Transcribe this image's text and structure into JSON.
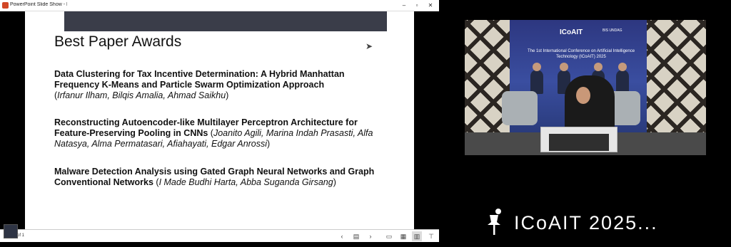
{
  "window": {
    "title": "PowerPoint Slide Show - Pres",
    "controls": [
      "–",
      "▫",
      "✕"
    ]
  },
  "slide": {
    "title": "Best Paper Awards",
    "papers": [
      {
        "title": "Data Clustering for Tax Incentive Determination: A Hybrid Manhattan Frequency K-Means and Particle Swarm Optimization Approach",
        "authors": "Irfanur Ilham, Bilqis Amalia, Ahmad Saikhu"
      },
      {
        "title": "Reconstructing Autoencoder-like Multilayer Perceptron Architecture for Feature-Preserving Pooling in CNNs",
        "authors": "Joanito Agili, Marina Indah Prasasti, Alfa Natasya, Alma Permatasari, Afiahayati, Edgar Anrossi"
      },
      {
        "title": "Malware Detection Analysis using Gated Graph Neural Networks and Graph Conventional Networks",
        "authors": "I Made Budhi Harta, Abba Suganda Girsang"
      }
    ]
  },
  "status_bar": {
    "slide_counter": "of 1",
    "icons": [
      "prev-slide-icon",
      "notes-icon",
      "next-slide-icon",
      "normal-view-icon",
      "slide-sorter-icon",
      "reading-view-icon",
      "presenter-view-icon"
    ]
  },
  "camera": {
    "banner_logo": "ICoAIT",
    "banner_sponsors": "BIS   UNDAG",
    "banner_text": "The 1st International Conference on Artificial Intelligence Technology (ICoAIT) 2025"
  },
  "meeting": {
    "name": "ICoAIT 2025...",
    "icon": "pin-icon"
  }
}
